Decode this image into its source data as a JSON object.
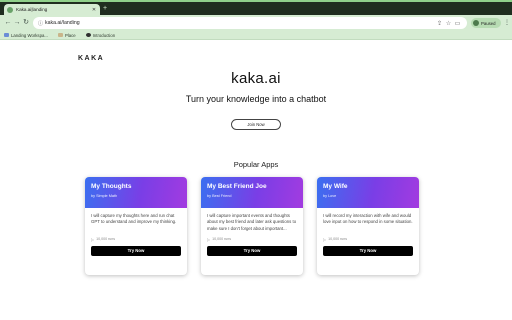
{
  "browser": {
    "tab_title": "Kaka.ai|landing",
    "url": "kaka.ai/landing",
    "profile_name": "Paused",
    "bookmarks": [
      {
        "label": "Landing Workspa...",
        "color": "#6a8cd6"
      },
      {
        "label": "Place",
        "color": "#c9b58a"
      },
      {
        "label": "Introduction",
        "color": "#2f2f2f"
      }
    ]
  },
  "page": {
    "logo": "KAKA",
    "title": "kaka.ai",
    "subtitle": "Turn your knowledge into a chatbot",
    "join_label": "Join Now",
    "section_title": "Popular Apps"
  },
  "apps": [
    {
      "title": "My Thoughts",
      "author": "by Simple Math",
      "description": "I will capture my thoughts here and run chat GPT to understand and improve my thinking.",
      "stat": "10,000 runs",
      "cta": "Try Now"
    },
    {
      "title": "My Best Friend Joe",
      "author": "by Best Friend",
      "description": "I will capture important events and thoughts about my best friend and later ask questions to make sure I don't forget about important...",
      "stat": "10,000 runs",
      "cta": "Try Now"
    },
    {
      "title": "My Wife",
      "author": "by Love",
      "description": "I will record my interaction with wife and would love input on how to respond in some situation.",
      "stat": "10,000 runs",
      "cta": "Try Now"
    }
  ],
  "colors": {
    "chrome_green": "#d6ecd3",
    "card_gradient_start": "#3b6ff0",
    "card_gradient_end": "#a23be0",
    "button_black": "#000000"
  }
}
